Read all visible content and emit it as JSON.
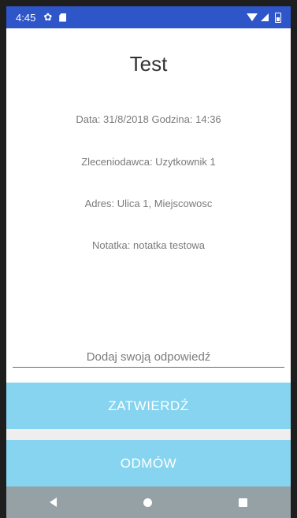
{
  "status_bar": {
    "time": "4:45",
    "icons": [
      "gear-icon",
      "sd-card-icon",
      "wifi-icon",
      "signal-icon",
      "battery-icon"
    ]
  },
  "page": {
    "title": "Test",
    "date_line": "Data: 31/8/2018 Godzina: 14:36",
    "client_line": "Zleceniodawca: Uzytkownik 1",
    "address_line": "Adres: Ulica 1, Miejscowosc",
    "note_line": "Notatka: notatka testowa"
  },
  "answer_input": {
    "placeholder": "Dodaj swoją odpowiedź",
    "value": ""
  },
  "buttons": {
    "confirm_label": "ZATWIERDŹ",
    "reject_label": "ODMÓW"
  },
  "nav_bar": {
    "icons": [
      "back-icon",
      "home-icon",
      "recents-icon"
    ]
  },
  "colors": {
    "status_bar": "#2f56c8",
    "button": "#86d4ef",
    "nav_bar": "#95a1a5"
  }
}
